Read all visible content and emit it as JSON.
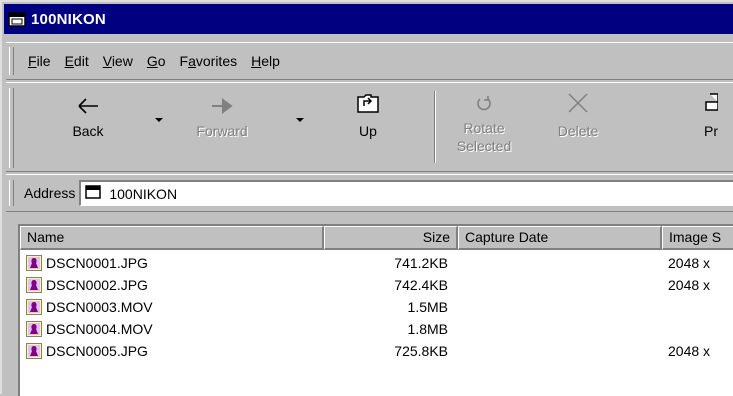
{
  "window": {
    "title": "100NIKON"
  },
  "menubar": {
    "items": [
      {
        "pre": "",
        "u": "F",
        "post": "ile"
      },
      {
        "pre": "",
        "u": "E",
        "post": "dit"
      },
      {
        "pre": "",
        "u": "V",
        "post": "iew"
      },
      {
        "pre": "",
        "u": "G",
        "post": "o"
      },
      {
        "pre": "F",
        "u": "a",
        "post": "vorites"
      },
      {
        "pre": "",
        "u": "H",
        "post": "elp"
      }
    ]
  },
  "toolbar": {
    "back_label": "Back",
    "forward_label": "Forward",
    "up_label": "Up",
    "rotate_label_1": "Rotate",
    "rotate_label_2": "Selected",
    "delete_label": "Delete",
    "print_label": "Pr"
  },
  "address": {
    "label": "Address",
    "value": "100NIKON"
  },
  "list": {
    "columns": [
      "Name",
      "Size",
      "Capture Date",
      "Image S"
    ],
    "rows": [
      {
        "name": "DSCN0001.JPG",
        "size": "741.2KB",
        "date": "",
        "image": "2048 x"
      },
      {
        "name": "DSCN0002.JPG",
        "size": "742.4KB",
        "date": "",
        "image": "2048 x"
      },
      {
        "name": "DSCN0003.MOV",
        "size": "1.5MB",
        "date": "",
        "image": ""
      },
      {
        "name": "DSCN0004.MOV",
        "size": "1.8MB",
        "date": "",
        "image": ""
      },
      {
        "name": "DSCN0005.JPG",
        "size": "725.8KB",
        "date": "",
        "image": "2048 x"
      }
    ]
  },
  "colors": {
    "titlebar": "#000080",
    "face": "#c0c0c0",
    "file_icon": "#800080"
  }
}
